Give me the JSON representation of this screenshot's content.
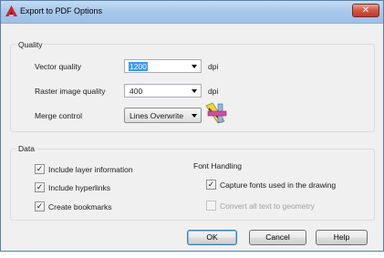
{
  "window": {
    "title": "Export to PDF Options",
    "close_glyph": "✕"
  },
  "quality": {
    "group_label": "Quality",
    "vector": {
      "label": "Vector quality",
      "value": "1200",
      "unit": "dpi"
    },
    "raster": {
      "label": "Raster image quality",
      "value": "400",
      "unit": "dpi"
    },
    "merge": {
      "label": "Merge control",
      "value": "Lines Overwrite"
    }
  },
  "data": {
    "group_label": "Data",
    "include_layer": {
      "label": "Include layer information",
      "checked": true
    },
    "include_hyperlinks": {
      "label": "Include hyperlinks",
      "checked": true
    },
    "create_bookmarks": {
      "label": "Create bookmarks",
      "checked": true
    }
  },
  "font_handling": {
    "label": "Font Handling",
    "capture_fonts": {
      "label": "Capture fonts used in the drawing",
      "checked": true
    },
    "convert_text": {
      "label": "Convert all text to geometry",
      "checked": false,
      "disabled": true
    }
  },
  "buttons": {
    "ok": "OK",
    "cancel": "Cancel",
    "help": "Help"
  },
  "check_glyph": "✓",
  "colors": {
    "title_bar": "#a9c9ec",
    "close_button": "#c3372a",
    "selection": "#3399ff"
  },
  "icons": {
    "app": "autocad-a-icon",
    "merge": "merge-control-lines-icon"
  }
}
